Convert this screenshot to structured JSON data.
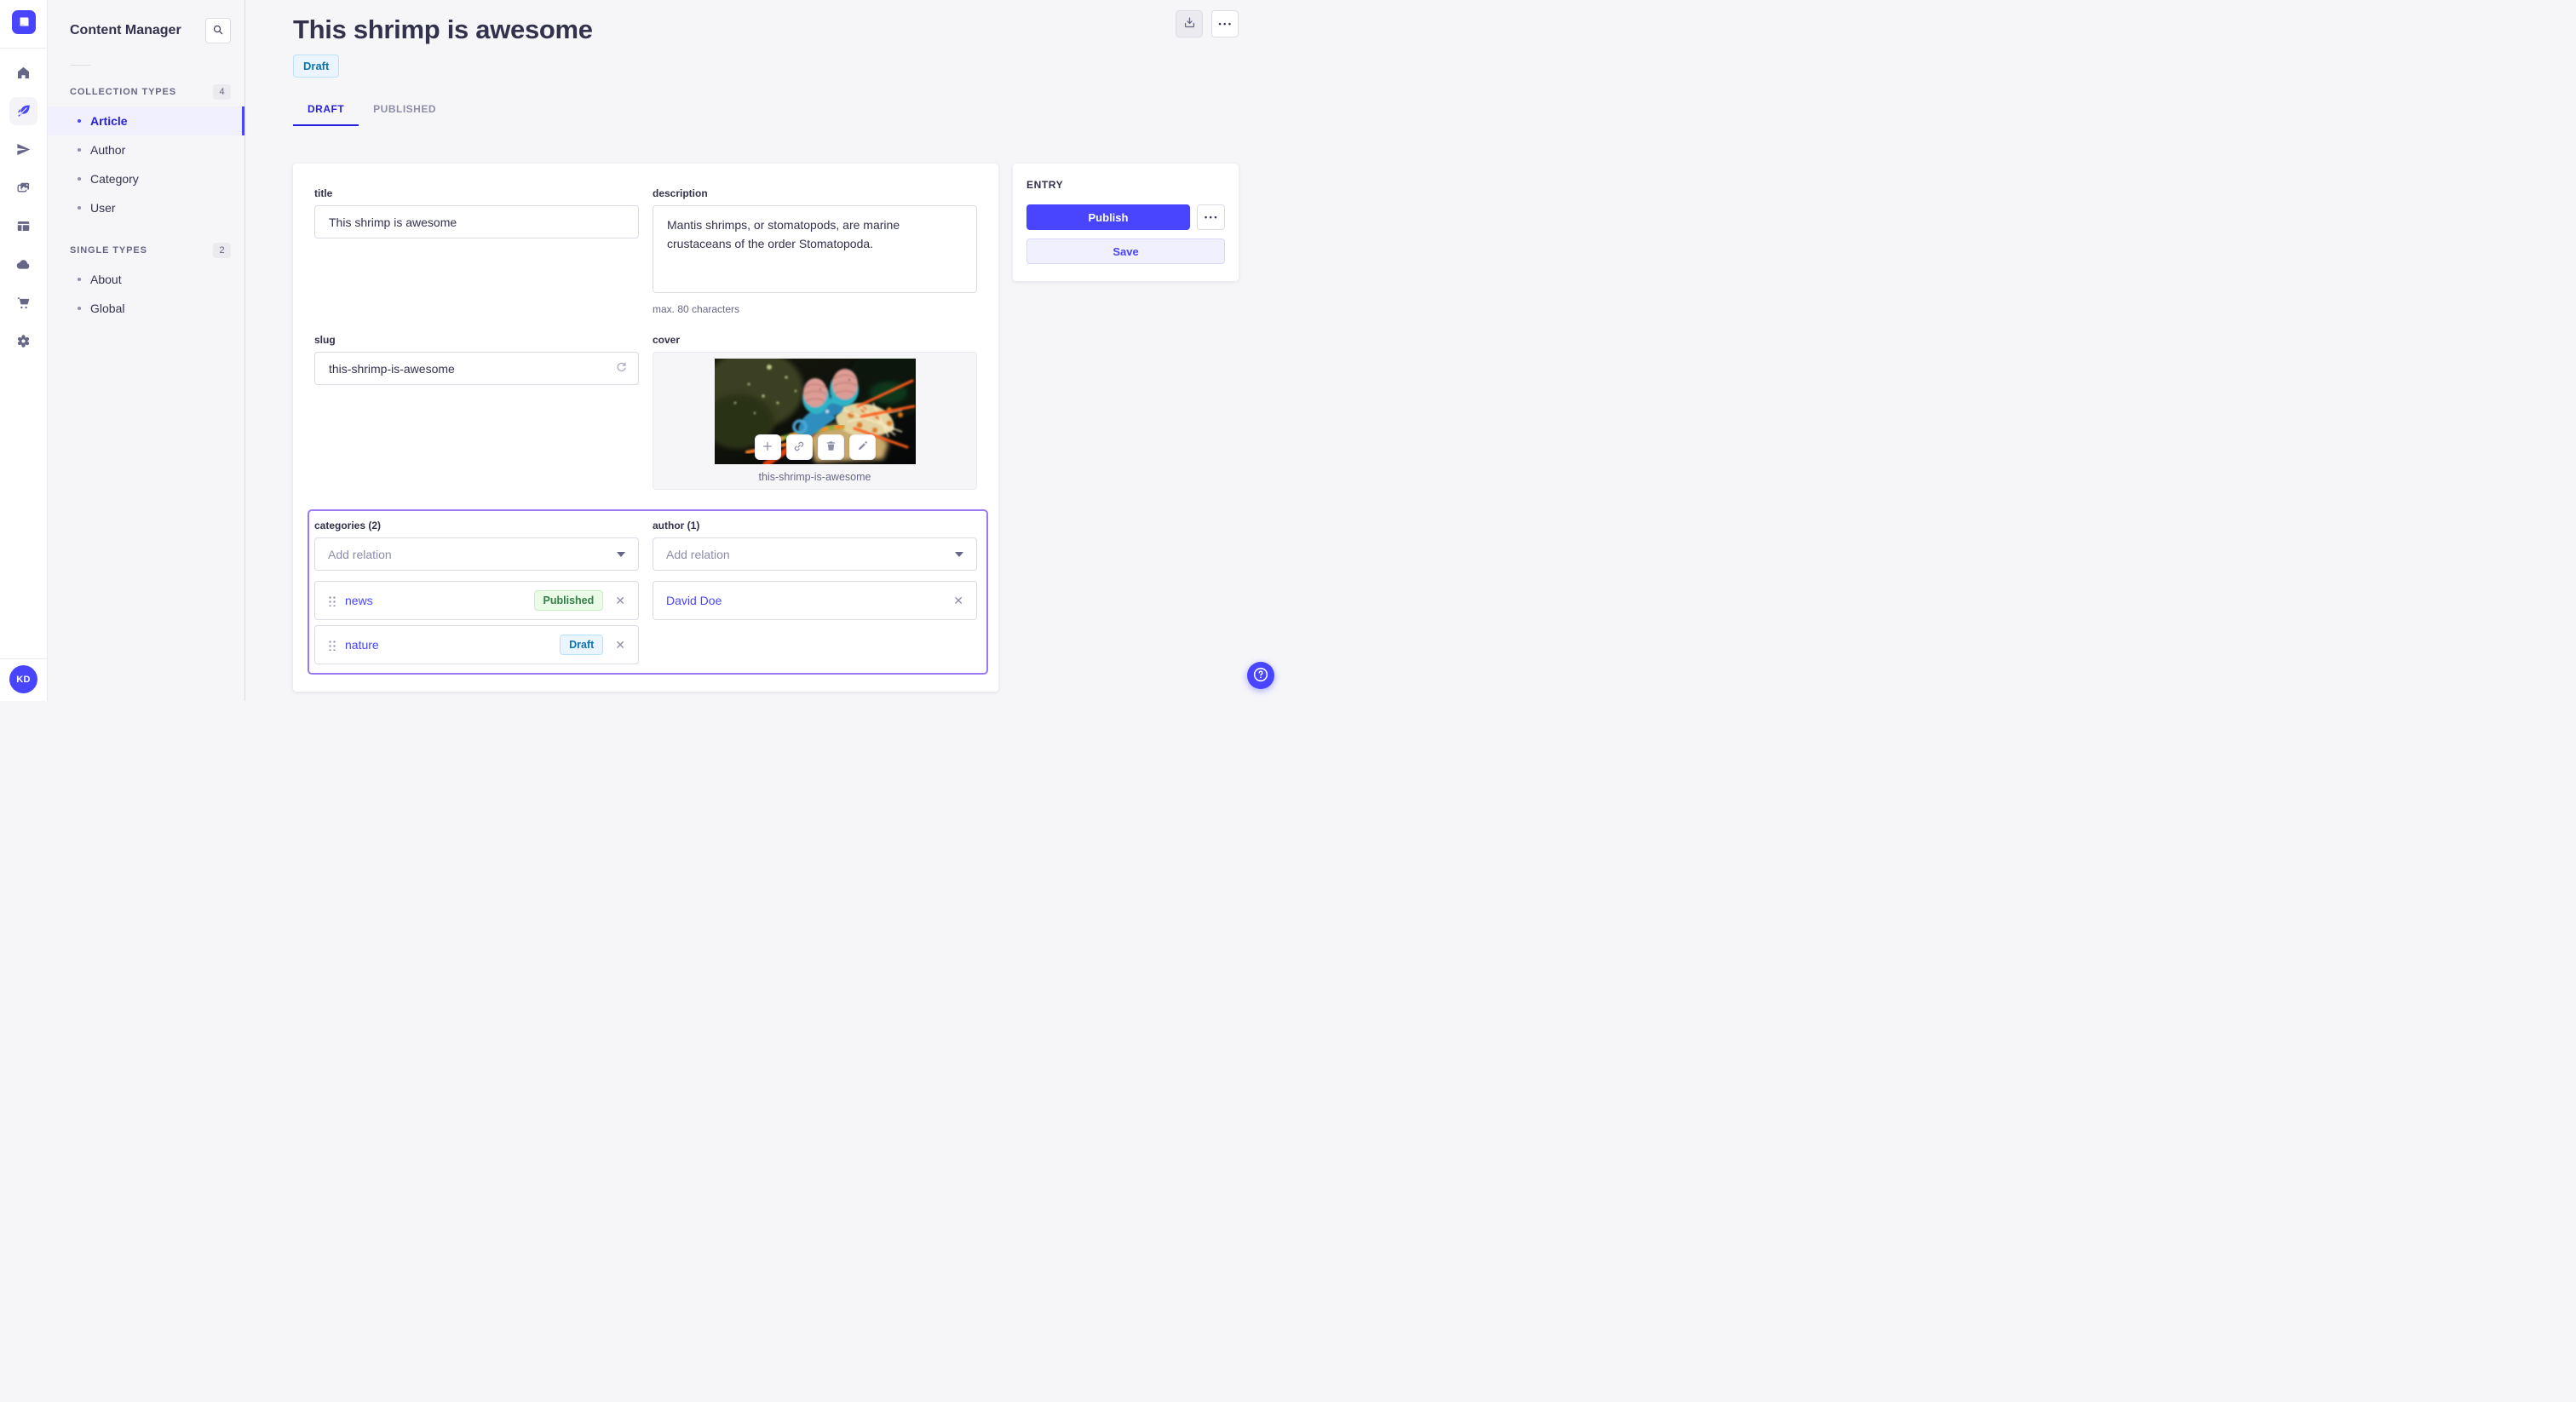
{
  "colors": {
    "primary": "#4945ff",
    "primary_dark": "#271fe0",
    "primary_light_bg": "#f0f0ff",
    "selection_border": "#9b7af5",
    "draft_text": "#0c75af",
    "draft_bg": "#eaf5ff",
    "published_text": "#328048",
    "published_bg": "#eafbe7",
    "neutral_text": "#32324d",
    "muted_text": "#666687",
    "background": "#f6f6f9"
  },
  "icons": {
    "close": "✕",
    "more": "•••",
    "logo": "strapi-logo",
    "rail": [
      "home-icon",
      "feather-icon",
      "paper-plane-icon",
      "media-library-icon",
      "layout-icon",
      "cloud-icon",
      "cart-icon",
      "gear-icon"
    ],
    "search": "search-icon",
    "download": "download-icon",
    "refresh": "refresh-icon",
    "cover_actions": [
      "plus-icon",
      "link-icon",
      "trash-icon",
      "pencil-icon"
    ],
    "help": "question-mark-icon"
  },
  "rail": {
    "avatar": "KD"
  },
  "sidebar": {
    "title": "Content Manager",
    "sections": [
      {
        "label": "COLLECTION TYPES",
        "count": "4",
        "items": [
          {
            "label": "Article"
          },
          {
            "label": "Author"
          },
          {
            "label": "Category"
          },
          {
            "label": "User"
          }
        ]
      },
      {
        "label": "SINGLE TYPES",
        "count": "2",
        "items": [
          {
            "label": "About"
          },
          {
            "label": "Global"
          }
        ]
      }
    ]
  },
  "header": {
    "title": "This shrimp is awesome",
    "status": "Draft"
  },
  "tabs": [
    {
      "label": "DRAFT"
    },
    {
      "label": "PUBLISHED"
    }
  ],
  "form": {
    "title": {
      "label": "title",
      "value": "This shrimp is awesome"
    },
    "description": {
      "label": "description",
      "value": "Mantis shrimps, or stomatopods, are marine crustaceans of the order Stomatopoda.",
      "hint": "max. 80 characters"
    },
    "slug": {
      "label": "slug",
      "value": "this-shrimp-is-awesome"
    },
    "cover": {
      "label": "cover",
      "caption": "this-shrimp-is-awesome"
    },
    "categories": {
      "label": "categories (2)",
      "placeholder": "Add relation",
      "items": [
        {
          "name": "news",
          "status": "Published"
        },
        {
          "name": "nature",
          "status": "Draft"
        }
      ]
    },
    "author": {
      "label": "author (1)",
      "placeholder": "Add relation",
      "items": [
        {
          "name": "David Doe"
        }
      ]
    }
  },
  "entry": {
    "title": "ENTRY",
    "publish": "Publish",
    "save": "Save"
  }
}
